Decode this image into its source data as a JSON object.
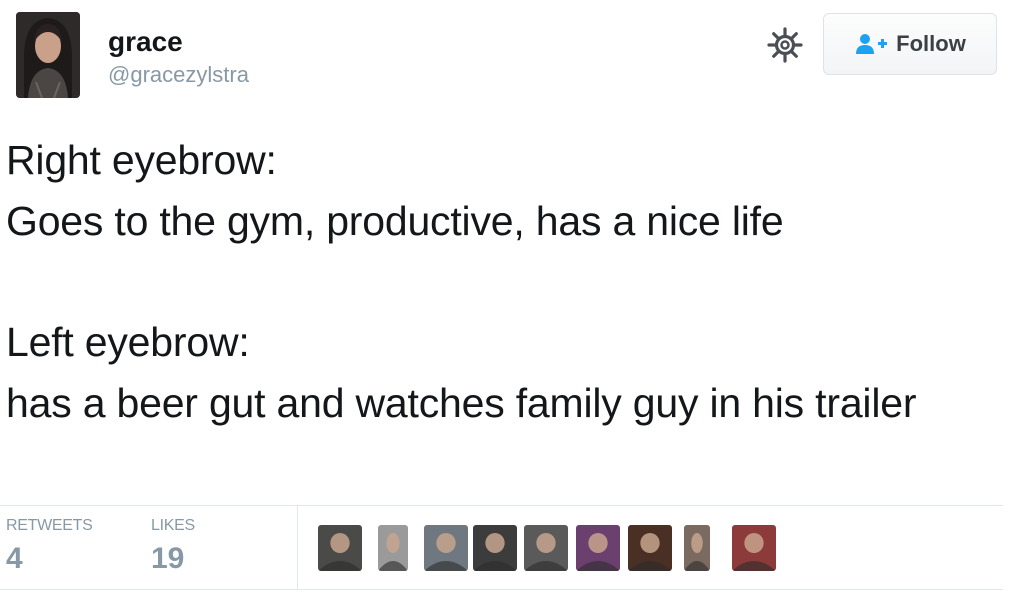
{
  "author": {
    "display_name": "grace",
    "handle": "@gracezylstra"
  },
  "actions": {
    "follow_label": "Follow",
    "settings_icon": "gear-icon",
    "follow_icon": "add-user-icon"
  },
  "tweet": {
    "lines": [
      "Right eyebrow:",
      "Goes to the gym, productive, has a nice life",
      "",
      "Left eyebrow:",
      "has a beer gut and watches family guy in his trailer"
    ]
  },
  "stats": {
    "retweets_label": "RETWEETS",
    "retweets_count": "4",
    "likes_label": "LIKES",
    "likes_count": "19"
  },
  "liker_avatars": [
    {
      "name": "liker-avatar-1",
      "color": "#4a4a48"
    },
    {
      "name": "liker-avatar-2",
      "color": "#9a9a9a"
    },
    {
      "name": "liker-avatar-3",
      "color": "#6f7880"
    },
    {
      "name": "liker-avatar-4",
      "color": "#3c3c3c"
    },
    {
      "name": "liker-avatar-5",
      "color": "#5a5a5a"
    },
    {
      "name": "liker-avatar-6",
      "color": "#6b3f6e"
    },
    {
      "name": "liker-avatar-7",
      "color": "#4a2f24"
    },
    {
      "name": "liker-avatar-8",
      "color": "#7a6a60"
    },
    {
      "name": "liker-avatar-9",
      "color": "#8c3a3a"
    }
  ],
  "colors": {
    "text": "#14171a",
    "muted": "#8899a6",
    "follow_accent": "#1da1f2"
  }
}
